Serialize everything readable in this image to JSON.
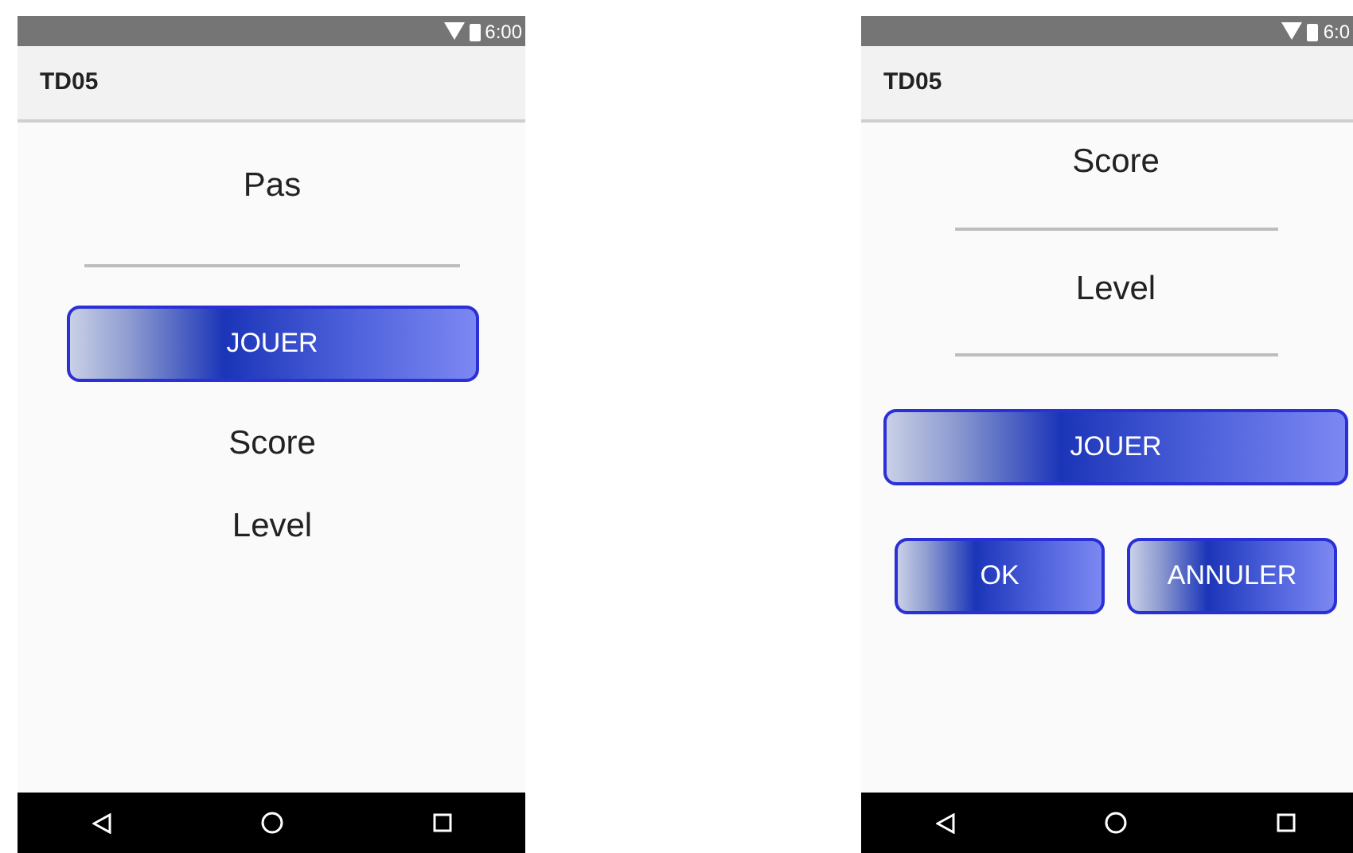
{
  "phones": [
    {
      "status_time": "6:00",
      "app_title": "TD05",
      "items": [
        {
          "kind": "label",
          "text": "Pas"
        },
        {
          "kind": "field"
        },
        {
          "kind": "button",
          "label": "JOUER"
        },
        {
          "kind": "label",
          "text": "Score"
        },
        {
          "kind": "label",
          "text": "Level"
        }
      ]
    },
    {
      "status_time": "6:0",
      "app_title": "TD05",
      "items": [
        {
          "kind": "label",
          "text": "Score"
        },
        {
          "kind": "field"
        },
        {
          "kind": "label",
          "text": "Level"
        },
        {
          "kind": "field"
        },
        {
          "kind": "button",
          "label": "JOUER"
        },
        {
          "kind": "button_row",
          "buttons": [
            {
              "label": "OK"
            },
            {
              "label": "ANNULER"
            }
          ]
        }
      ]
    }
  ]
}
